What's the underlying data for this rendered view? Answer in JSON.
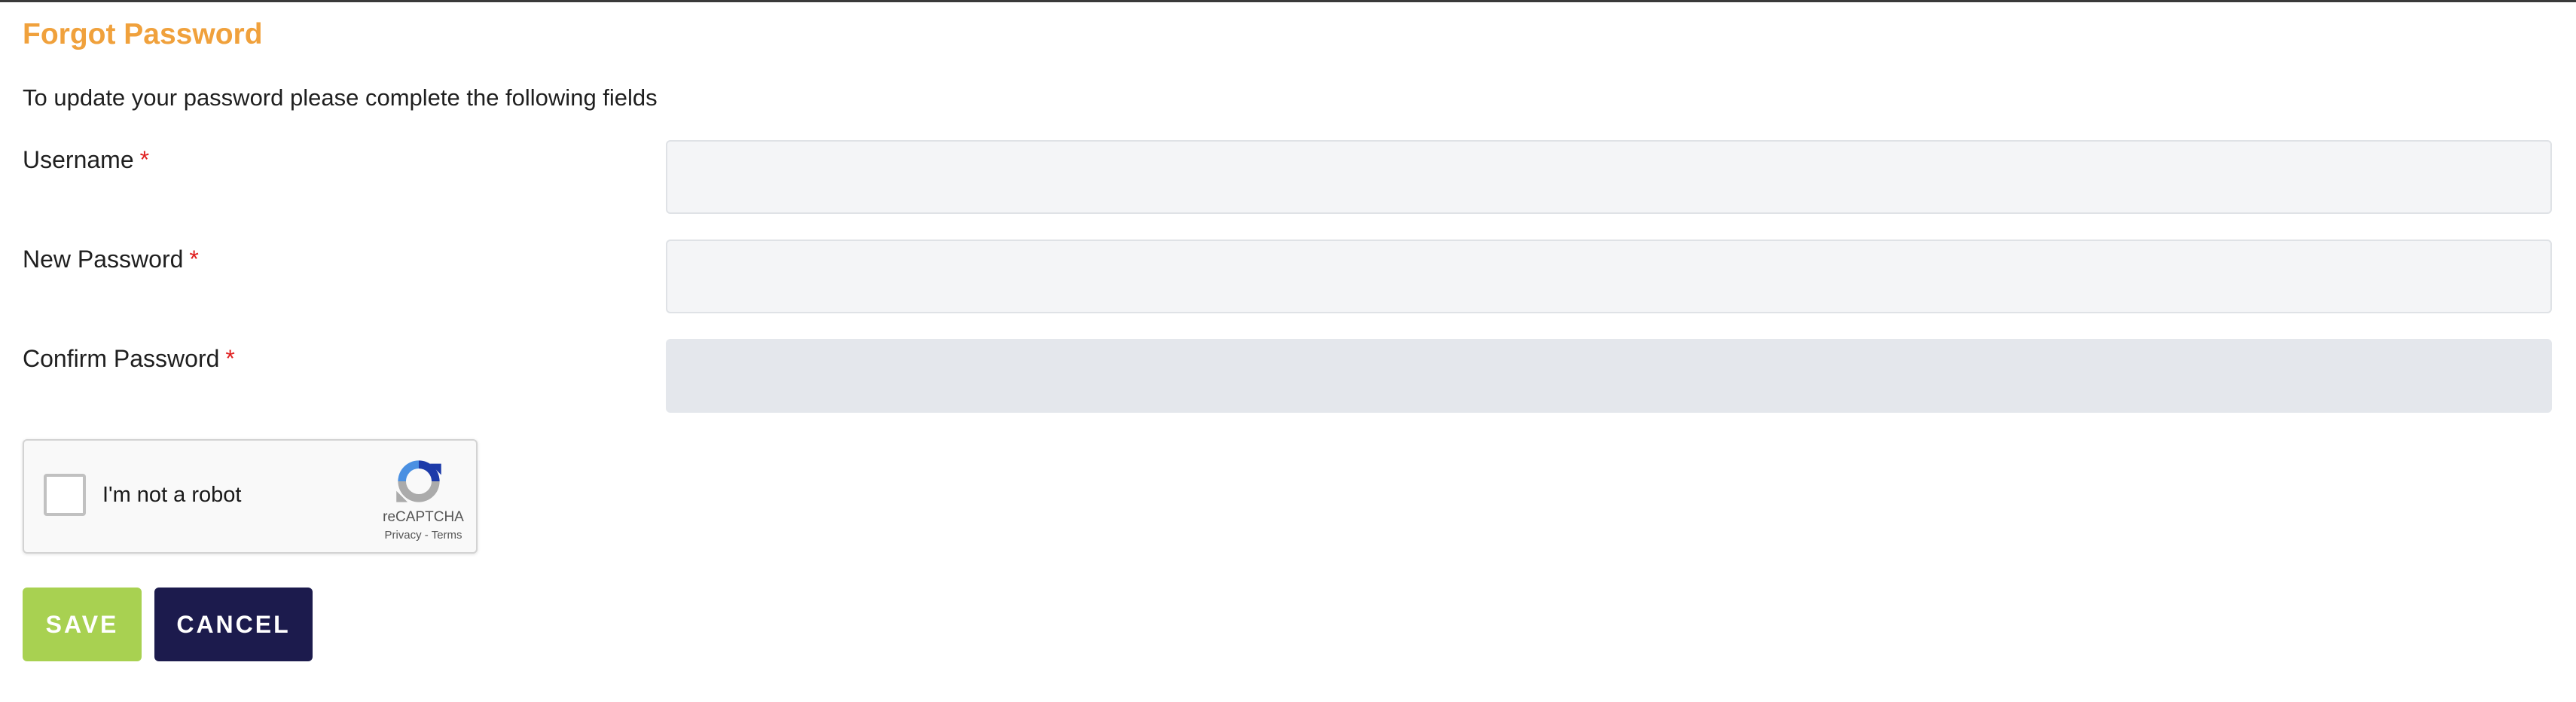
{
  "page": {
    "title": "Forgot Password",
    "intro": "To update your password please complete the following fields"
  },
  "form": {
    "required_marker": "*",
    "username": {
      "label": "Username",
      "value": "",
      "placeholder": ""
    },
    "new_password": {
      "label": "New Password",
      "value": "",
      "placeholder": ""
    },
    "confirm_password": {
      "label": "Confirm Password",
      "value": "",
      "placeholder": ""
    }
  },
  "captcha": {
    "label": "I'm not a robot",
    "brand": "reCAPTCHA",
    "privacy": "Privacy",
    "separator": " - ",
    "terms": "Terms",
    "icon": "recaptcha-logo"
  },
  "actions": {
    "save_label": "SAVE",
    "cancel_label": "CANCEL"
  },
  "colors": {
    "title": "#f0a13c",
    "required": "#e02020",
    "save_button": "#a8d151",
    "cancel_button": "#1c1b4d"
  }
}
